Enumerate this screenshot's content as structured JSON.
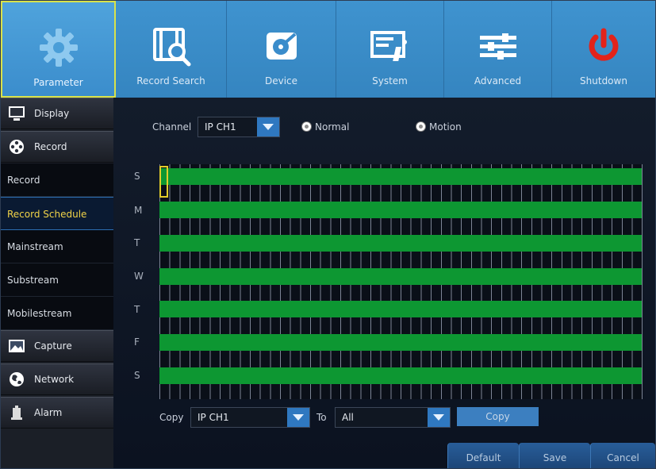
{
  "topbar": {
    "tabs": [
      {
        "label": "Parameter",
        "icon": "gear-icon"
      },
      {
        "label": "Record Search",
        "icon": "film-search-icon"
      },
      {
        "label": "Device",
        "icon": "hard-disk-icon"
      },
      {
        "label": "System",
        "icon": "monitor-info-icon"
      },
      {
        "label": "Advanced",
        "icon": "sliders-icon"
      },
      {
        "label": "Shutdown",
        "icon": "power-icon"
      }
    ],
    "active_tab": "Parameter"
  },
  "sidebar": {
    "categories": {
      "display": {
        "label": "Display",
        "icon": "monitor-icon"
      },
      "record": {
        "label": "Record",
        "icon": "film-reel-icon"
      },
      "capture": {
        "label": "Capture",
        "icon": "image-icon"
      },
      "network": {
        "label": "Network",
        "icon": "globe-icon"
      },
      "alarm": {
        "label": "Alarm",
        "icon": "alarm-icon"
      }
    },
    "record_items": [
      "Record",
      "Record Schedule",
      "Mainstream",
      "Substream",
      "Mobilestream"
    ],
    "active_item": "Record Schedule"
  },
  "main": {
    "channel_label": "Channel",
    "channel_value": "IP CH1",
    "mode_options": [
      {
        "label": "Normal",
        "icon": "radio-icon"
      },
      {
        "label": "Motion",
        "icon": "radio-icon"
      }
    ],
    "schedule": {
      "days": [
        "S",
        "M",
        "T",
        "W",
        "T",
        "F",
        "S"
      ],
      "recording_color": "#0d9732",
      "all_slots_recording": true
    },
    "copy_label": "Copy",
    "copy_from_value": "IP CH1",
    "to_label": "To",
    "to_value": "All",
    "copy_button": "Copy"
  },
  "footer": {
    "default_button": "Default",
    "save_button": "Save",
    "cancel_button": "Cancel"
  },
  "colors": {
    "accent_blue": "#3f93cf",
    "active_highlight": "#d9e24a",
    "active_menu_text": "#f1d348",
    "schedule_green": "#0d9732"
  }
}
